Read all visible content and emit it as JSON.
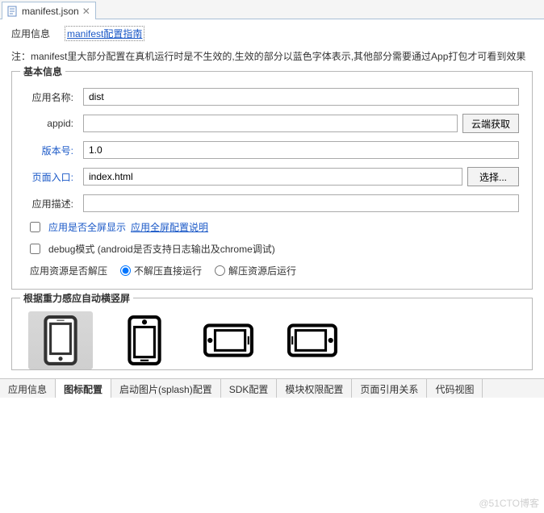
{
  "fileTab": {
    "name": "manifest.json",
    "close": "✕"
  },
  "subtabs": {
    "appInfo": "应用信息",
    "configGuide": "manifest配置指南"
  },
  "note": "注：manifest里大部分配置在真机运行时是不生效的,生效的部分以蓝色字体表示,其他部分需要通过App打包才可看到效果",
  "basic": {
    "legend": "基本信息",
    "appNameLabel": "应用名称:",
    "appName": "dist",
    "appidLabel": "appid:",
    "appid": "",
    "cloudGet": "云端获取",
    "versionLabel": "版本号:",
    "version": "1.0",
    "entryLabel": "页面入口:",
    "entry": "index.html",
    "chooseBtn": "选择...",
    "descLabel": "应用描述:",
    "desc": "",
    "fullscreenChk": "应用是否全屏显示",
    "fullscreenHelp": "应用全屏配置说明",
    "debugChk": "debug模式 (android是否支持日志输出及chrome调试)",
    "unzipLabel": "应用资源是否解压",
    "unzipOpt1": "不解压直接运行",
    "unzipOpt2": "解压资源后运行"
  },
  "orient": {
    "legend": "根据重力感应自动横竖屏"
  },
  "bottomTabs": {
    "t0": "应用信息",
    "t1": "图标配置",
    "t2": "启动图片(splash)配置",
    "t3": "SDK配置",
    "t4": "模块权限配置",
    "t5": "页面引用关系",
    "t6": "代码视图"
  },
  "watermark": "@51CTO博客"
}
